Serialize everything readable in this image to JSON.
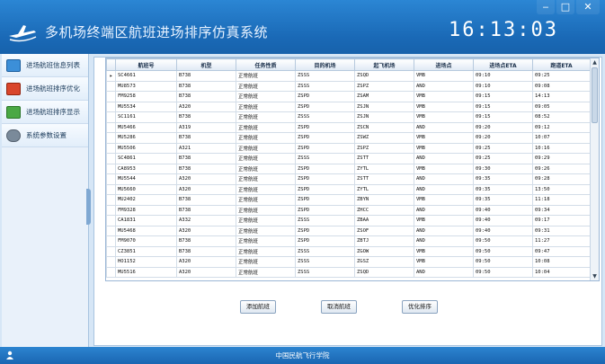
{
  "header": {
    "title": "多机场终端区航班进场排序仿真系统",
    "clock": "16:13:03"
  },
  "window_controls": [
    "‒",
    "□",
    "✕"
  ],
  "sidebar": {
    "items": [
      {
        "label": "进场航班信息列表",
        "icon": "flight-list-icon",
        "color": "#3c8fd8"
      },
      {
        "label": "进场航班排序优化",
        "icon": "optimize-icon",
        "color": "#d9452b"
      },
      {
        "label": "进场航班排序显示",
        "icon": "chart-icon",
        "color": "#4aa844"
      },
      {
        "label": "系统参数设置",
        "icon": "gear-icon",
        "color": "#7a8a9a"
      }
    ]
  },
  "table": {
    "columns": [
      "航班号",
      "机型",
      "任务性质",
      "目的机场",
      "起飞机场",
      "进场点",
      "进场点ETA",
      "跑道ETA"
    ],
    "rows": [
      [
        "SC4661",
        "B738",
        "正常航班",
        "ZSSS",
        "ZSQD",
        "VMB",
        "09:10",
        "09:25"
      ],
      [
        "MU8573",
        "B738",
        "正常航班",
        "ZSSS",
        "ZSPZ",
        "AND",
        "09:10",
        "09:08"
      ],
      [
        "FM9258",
        "B738",
        "正常航班",
        "ZSPD",
        "ZSAM",
        "VMB",
        "09:15",
        "14:13"
      ],
      [
        "MU5534",
        "A320",
        "正常航班",
        "ZSPD",
        "ZSJN",
        "VMB",
        "09:15",
        "09:05"
      ],
      [
        "SC1161",
        "B738",
        "正常航班",
        "ZSSS",
        "ZSJN",
        "VMB",
        "09:15",
        "08:52"
      ],
      [
        "MU5466",
        "A319",
        "正常航班",
        "ZSPD",
        "ZSCN",
        "AND",
        "09:20",
        "09:12"
      ],
      [
        "MU5286",
        "B738",
        "正常航班",
        "ZSPD",
        "ZSWZ",
        "VMB",
        "09:20",
        "10:07"
      ],
      [
        "MU5506",
        "A321",
        "正常航班",
        "ZSPD",
        "ZSPZ",
        "VMB",
        "09:25",
        "10:16"
      ],
      [
        "SC4861",
        "B738",
        "正常航班",
        "ZSSS",
        "ZSTT",
        "AND",
        "09:25",
        "09:29"
      ],
      [
        "CA8953",
        "B738",
        "正常航班",
        "ZSPD",
        "ZYTL",
        "VMB",
        "09:30",
        "09:26"
      ],
      [
        "MU5544",
        "A320",
        "正常航班",
        "ZSPD",
        "ZSTT",
        "AND",
        "09:35",
        "09:28"
      ],
      [
        "MU5660",
        "A320",
        "正常航班",
        "ZSPD",
        "ZYTL",
        "AND",
        "09:35",
        "13:50"
      ],
      [
        "MU2402",
        "B738",
        "正常航班",
        "ZSPD",
        "ZBYN",
        "VMB",
        "09:35",
        "11:18"
      ],
      [
        "FM9328",
        "B738",
        "正常航班",
        "ZSPD",
        "ZHCC",
        "AND",
        "09:40",
        "09:34"
      ],
      [
        "CA1831",
        "A332",
        "正常航班",
        "ZSSS",
        "ZBAA",
        "VMB",
        "09:40",
        "09:17"
      ],
      [
        "MU5468",
        "A320",
        "正常航班",
        "ZSPD",
        "ZSOF",
        "AND",
        "09:40",
        "09:31"
      ],
      [
        "FM9070",
        "B738",
        "正常航班",
        "ZSPD",
        "ZBTJ",
        "AND",
        "09:50",
        "11:27"
      ],
      [
        "CZ3851",
        "B738",
        "正常航班",
        "ZSSS",
        "ZGOW",
        "VMB",
        "09:50",
        "09:47"
      ],
      [
        "HO1152",
        "A320",
        "正常航班",
        "ZSSS",
        "ZGSZ",
        "VMB",
        "09:50",
        "10:08"
      ],
      [
        "MU5516",
        "A320",
        "正常航班",
        "ZSSS",
        "ZSQD",
        "AND",
        "09:50",
        "10:04"
      ]
    ],
    "current_row_marker": "▸"
  },
  "buttons": {
    "add": "添加航班",
    "cancel": "取消航班",
    "optimize": "优化排序"
  },
  "footer": {
    "text": "中国民航飞行学院"
  }
}
